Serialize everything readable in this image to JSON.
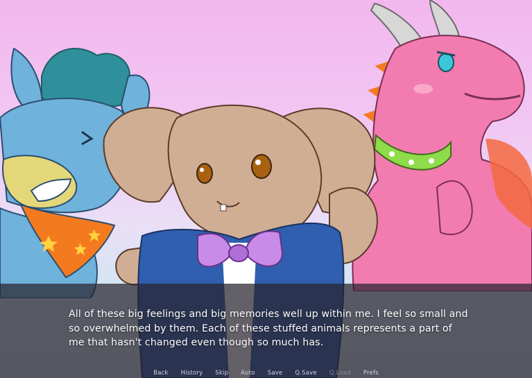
{
  "dialogue": {
    "text": "All of these big feelings and big memories well up within me. I feel so small and so overwhelmed by them. Each of these stuffed animals represents a part of me that hasn't changed even though so much has."
  },
  "quick_menu": [
    {
      "label": "Back",
      "enabled": true
    },
    {
      "label": "History",
      "enabled": true
    },
    {
      "label": "Skip",
      "enabled": true
    },
    {
      "label": "Auto",
      "enabled": true
    },
    {
      "label": "Save",
      "enabled": true
    },
    {
      "label": "Q.Save",
      "enabled": true
    },
    {
      "label": "Q.Load",
      "enabled": false
    },
    {
      "label": "Prefs",
      "enabled": true
    }
  ],
  "characters": [
    "blue-horse-plush",
    "tan-bunny-plush",
    "pink-dragon-plush"
  ],
  "colors": {
    "sky_top": "#f2b7ee",
    "sky_bottom": "#c9dce6",
    "horse": "#6fb2dc",
    "horse_mane": "#2f8f9a",
    "bandana": "#f47a1f",
    "bunny": "#cfae93",
    "bunny_outfit": "#2f5fae",
    "bow": "#c88be8",
    "dragon": "#f27bb0",
    "collar": "#8fdc4a",
    "dialogue_bg": "rgba(40,34,44,0.72)"
  }
}
